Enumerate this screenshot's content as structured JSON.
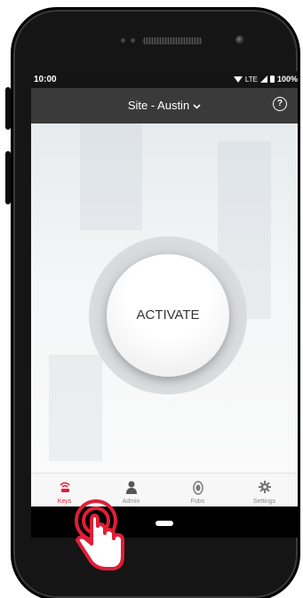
{
  "status_bar": {
    "time": "10:00",
    "network": "LTE",
    "battery": "100%"
  },
  "header": {
    "site_label": "Site - Austin",
    "dropdown_icon": "chevron-down-icon",
    "help_icon": "help-circle-icon"
  },
  "main": {
    "activate_label": "ACTIVATE"
  },
  "tabs": [
    {
      "label": "Keys",
      "icon": "keys-wireless-icon",
      "active": true
    },
    {
      "label": "Admin",
      "icon": "admin-person-icon",
      "active": false
    },
    {
      "label": "Fobs",
      "icon": "fob-icon",
      "active": false
    },
    {
      "label": "Settings",
      "icon": "gear-icon",
      "active": false
    }
  ],
  "colors": {
    "accent": "#e01e37",
    "app_bar": "#3a3a3a",
    "tab_inactive": "#8a8a8a"
  }
}
